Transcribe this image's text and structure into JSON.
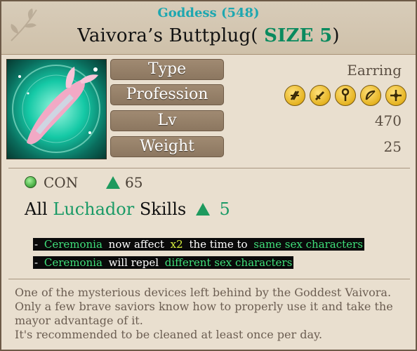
{
  "item": {
    "grade_text": "Goddess (548)",
    "name": "Vaivora’s Buttplug",
    "size_label": "SIZE",
    "size_value": "5",
    "paren_open": "(",
    "paren_close": ")"
  },
  "properties": {
    "type_label": "Type",
    "type_value": "Earring",
    "profession_label": "Profession",
    "level_label": "Lv",
    "level_value": "470",
    "weight_label": "Weight",
    "weight_value": "25",
    "profession_icons": [
      "warrior-class-icon",
      "swordsman-class-icon",
      "cleric-class-icon",
      "archer-class-icon",
      "scout-class-icon"
    ]
  },
  "stats": {
    "con_label": "CON",
    "con_value": "65"
  },
  "skill_bonus": {
    "prefix": "All",
    "class_name": "Luchador",
    "suffix": "Skills",
    "value": "5"
  },
  "effects": [
    {
      "dash": "- ",
      "parts": [
        {
          "text": "Ceremonia",
          "style": "g"
        },
        {
          "text": " now affect ",
          "style": "w"
        },
        {
          "text": "x2",
          "style": "y"
        },
        {
          "text": " the time to ",
          "style": "w"
        },
        {
          "text": "same sex characters",
          "style": "g"
        }
      ]
    },
    {
      "dash": "- ",
      "parts": [
        {
          "text": "Ceremonia",
          "style": "g"
        },
        {
          "text": " will repel ",
          "style": "w"
        },
        {
          "text": "different sex characters",
          "style": "g"
        }
      ]
    }
  ],
  "description": [
    "One of the mysterious devices left behind by the Goddest Vaivora.",
    "Only a few brave saviors know how to properly use it and take the",
    "mayor advantage of it.",
    "It's recommended to be cleaned at least once per day."
  ],
  "colors": {
    "grade": "#1ea7b0",
    "accent_green": "#1a9a66",
    "parchment": "#e9dfcf"
  }
}
